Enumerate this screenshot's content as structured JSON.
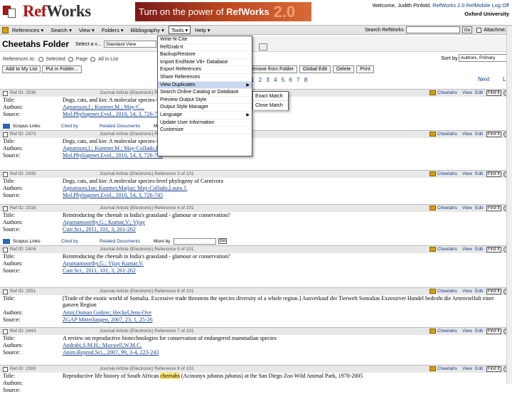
{
  "header": {
    "logo_text_a": "Ref",
    "logo_text_b": "Works",
    "banner_text_a": "Turn on the power of",
    "banner_brand_a": "Ref",
    "banner_brand_b": "Works",
    "banner_version": "2.0",
    "welcome_prefix": "Welcome, Judith Pinfold.",
    "welcome_link1": "RefWorks 2.0",
    "welcome_link2": "RefMobile",
    "welcome_link3": "Log Off",
    "org_name": "Oxford University",
    "brand_color": "#b01616"
  },
  "menubar": {
    "items": [
      "References",
      "Search",
      "View",
      "Folders",
      "Bibliography",
      "Tools",
      "Help"
    ],
    "open_item": "Tools",
    "search_label": "Search RefWorks",
    "search_value": "",
    "go_label": "Go",
    "attachments_label": "Attachme..."
  },
  "folder": {
    "title": "Cheetahs Folder",
    "select_label": "Select a v...",
    "view_value": "Standard View",
    "sort_label": "Sort by",
    "sort_value": "Authors, Primary"
  },
  "references_bar": {
    "label": "References to:",
    "options": [
      "Selected",
      "Page",
      "All in List"
    ],
    "buttons": [
      "Add to My List",
      "Put in Folder..."
    ],
    "right_buttons": [
      "Remove from Folder",
      "Global Edit",
      "Delete",
      "Print"
    ]
  },
  "pagination": {
    "pages": "1 2 3 4 5 6 7 8",
    "next": "Next",
    "last": "Last"
  },
  "tools_menu": {
    "items": [
      {
        "label": "Write-N-Cite",
        "has_submenu": false
      },
      {
        "label": "RefGrab-It",
        "has_submenu": false
      },
      {
        "label": "Backup/Restore",
        "has_submenu": false
      },
      {
        "label": "Import EndNote V8+ Database",
        "has_submenu": false
      },
      {
        "label": "Export References",
        "has_submenu": false
      },
      {
        "label": "Share References",
        "has_submenu": false
      },
      {
        "label": "View Duplicates",
        "has_submenu": true
      },
      {
        "label": "Search Online Catalog or Database",
        "has_submenu": false
      },
      {
        "label": "Preview Output Style",
        "has_submenu": false
      },
      {
        "label": "Output Style Manager",
        "has_submenu": false
      },
      {
        "label": "Language",
        "has_submenu": true
      },
      {
        "label": "Update User Information",
        "has_submenu": false
      },
      {
        "label": "Customize",
        "has_submenu": false
      }
    ],
    "highlighted": "View Duplicates",
    "submenu": [
      "Exact Match",
      "Close Match"
    ]
  },
  "field_labels": {
    "title": "Title:",
    "authors": "Authors:",
    "source": "Source:"
  },
  "row_actions": {
    "folder": "Cheetahs",
    "view": "View",
    "edit": "Edit",
    "find": "Find It"
  },
  "scopus": {
    "label": "Scopus Links",
    "cited": "Cited by",
    "related": "Related Documents",
    "more": "More by",
    "go": "Go"
  },
  "references": [
    {
      "id": "Ref ID: 2530",
      "type": "Journal Article (Electronic) Reference 1 of 101",
      "title": "Dogs, cats, and kin: A molecular species-level phylogeny of Carnivora",
      "authors": "Agnarsson,I.; Kuntner,M.; May-C...",
      "source": "Mol.Phylogenet.Evol., 2010, 54, 3, 726-745"
    },
    {
      "id": "Ref ID: 2473",
      "type": "Journal Article (Electronic) Reference 2 of 101",
      "title": "Dogs, cats, and kin: A molecular species-level phylogeny of Carnivora",
      "authors": "Agnarsson,I.; Kuntner,M.; May-Collado,L.J.",
      "source": "Mol.Phylogenet.Evol., 2010, 54, 3, 726-745"
    },
    {
      "id": "Ref ID: 2435",
      "type": "Journal Article (Electronic) Reference 3 of 101",
      "title": "Dogs, cats, and kin: A molecular species-level phylogeny of Carnivora",
      "authors": "Agnarsson,Ian; Kuntner,Matjaz; May-Collado,Laura J.",
      "source": "Mol.Phylogenet.Evol., 2010, 54, 3, 726-745"
    },
    {
      "id": "Ref ID: 2318",
      "type": "Journal Article (Electronic) Reference 4 of 101",
      "title": "Reintroducing the cheetah in India's grassland - glamour or conservation?",
      "authors": "Aparnamoorthy,G.; Kumar,V.; Vijay",
      "source": "Curr.Sci., 2011, 101, 3, 261-262"
    },
    {
      "id": "Ref ID: 2404",
      "type": "Journal Article (Electronic) Reference 5 of 101",
      "title": "Reintroducing the cheetah in India's grassland - glamour or conservation?",
      "authors": "Aparnamoorthy,G.; Vijay Kumar,V.",
      "source": "Curr.Sci., 2011, 101, 3, 261-262"
    },
    {
      "id": "Ref ID: 2551",
      "type": "Journal Article (Electronic) Reference 6 of 101",
      "title": "[Trade of the exotic world of Somalia. Excessive trade threatens the species diversity of a whole region.] Ausverkauf der Tierwelt Somalias Exzessiver Handel bedroht die Artenvielfalt einer ganzen Region",
      "authors": "Amir,Osman Gedow; Heckel,Jens-Ove",
      "source": "ZGAP Mitteilungen, 2007, 23, 1, 25-26"
    },
    {
      "id": "Ref ID: 2443",
      "type": "Journal Article (Electronic) Reference 7 of 101",
      "title": "A review on reproductive biotechnologies for conservation of endangered mammalian species",
      "authors": "Andrabi,S.M.H.; Maxwell,W.M.C.",
      "source": "Anim.Reprod.Sci., 2007, 99, 3-4, 223-243"
    },
    {
      "id": "Ref ID: 2393",
      "type": "Journal Article (Electronic) Reference 8 of 101",
      "title_pre": "Reproductive life history of South African ",
      "title_hl": "cheetahs",
      "title_post": " (Acinonyx jubatus jubatus) at the San Diego Zoo Wild Animal Park, 1970-2005",
      "authors": "",
      "source": ""
    }
  ]
}
